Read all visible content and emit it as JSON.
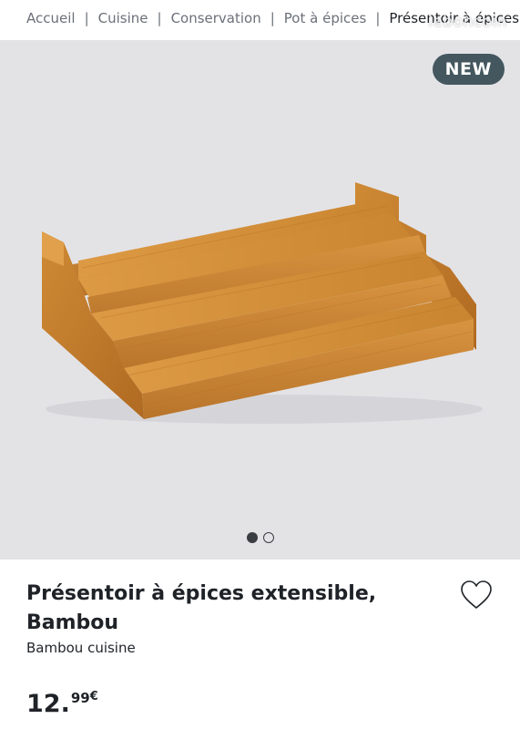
{
  "breadcrumb": {
    "items": [
      "Accueil",
      "Cuisine",
      "Conservation",
      "Pot à épices"
    ],
    "current": "Présentoir à épices exte",
    "separator": "|"
  },
  "watermark": "leboncoin",
  "gallery": {
    "badge": "NEW",
    "total_images": 2,
    "active_index": 0,
    "image_icon": "bamboo-spice-rack-image"
  },
  "product": {
    "title_line1": "Présentoir à épices extensible,",
    "title_line2": "Bambou",
    "brand": "Bambou cuisine",
    "price_int": "12.",
    "price_dec": "99",
    "currency": "€"
  },
  "icons": {
    "favorite": "heart-icon"
  },
  "colors": {
    "badge_bg": "#44575f",
    "gallery_bg": "#e3e3e6",
    "wood": "#d4903a",
    "text": "#1f2328",
    "muted": "#6b7079"
  }
}
